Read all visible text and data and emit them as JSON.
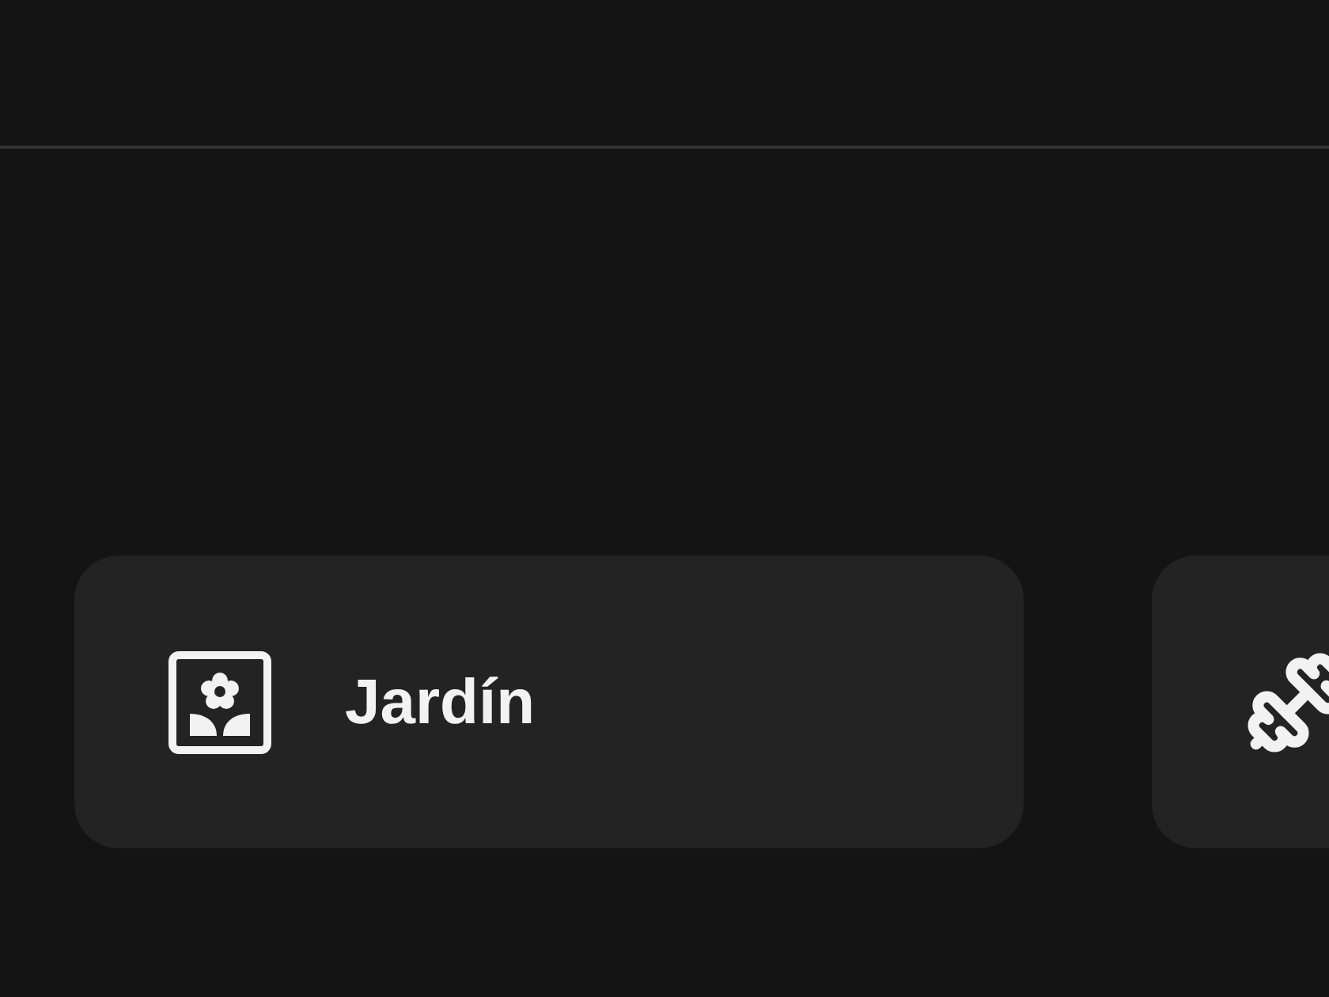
{
  "cards": [
    {
      "kind": "garden",
      "label": "Jardín"
    },
    {
      "kind": "fitness"
    }
  ]
}
